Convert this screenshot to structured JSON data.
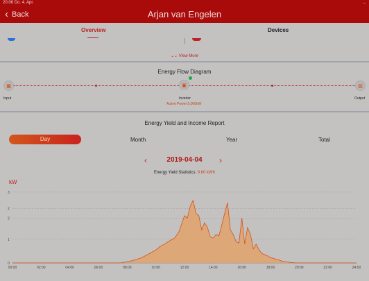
{
  "status_bar": {
    "time": "20:06",
    "date": "Do. 4. Apr.",
    "right": "..."
  },
  "nav": {
    "back_label": "Back",
    "title": "Arjan van Engelen"
  },
  "tabs": {
    "overview": "Overview",
    "devices": "Devices"
  },
  "summary": {
    "view_more": "View More"
  },
  "flow": {
    "title": "Energy Flow Diagram",
    "input_label": "Input",
    "inverter_label": "Inverter",
    "output_label": "Output",
    "active_power": "Active Power:0.000kW"
  },
  "report": {
    "title": "Energy Yield and Income Report",
    "segments": {
      "day": "Day",
      "month": "Month",
      "year": "Year",
      "total": "Total"
    },
    "date": "2019-04-04",
    "stats_label": "Energy Yield Statistics:",
    "stats_value": "9.60 kWh"
  },
  "colors": {
    "accent": "#a90b0b",
    "series_fill": "#e3a26b",
    "series_line": "#d2521a"
  },
  "chart_data": {
    "type": "area",
    "ylabel": "kW",
    "ylim": [
      0,
      3.2
    ],
    "yticks": [
      "0",
      "1",
      "2",
      "2",
      "3"
    ],
    "ytick_values": [
      0,
      1,
      1.9,
      2.3,
      3
    ],
    "xticks": [
      "00:00",
      "02:00",
      "04:00",
      "06:00",
      "08:00",
      "10:00",
      "12:00",
      "14:00",
      "16:00",
      "18:00",
      "20:00",
      "22:00",
      "24:00"
    ],
    "x": [
      0,
      7.5,
      8,
      8.5,
      9,
      9.5,
      10,
      10.3,
      10.6,
      11,
      11.3,
      11.6,
      12,
      12.2,
      12.4,
      12.6,
      12.8,
      13,
      13.2,
      13.4,
      13.6,
      13.8,
      14,
      14.2,
      14.4,
      14.6,
      14.8,
      15,
      15.2,
      15.4,
      15.6,
      15.8,
      16,
      16.2,
      16.4,
      16.6,
      16.8,
      17,
      17.2,
      17.4,
      17.6,
      17.8,
      18,
      18.2,
      18.4,
      18.6,
      18.8,
      19,
      19.2,
      19.4,
      19.6,
      19.8,
      20,
      24
    ],
    "series": [
      {
        "name": "",
        "values": [
          0,
          0,
          0.05,
          0.12,
          0.22,
          0.38,
          0.55,
          0.7,
          0.8,
          0.95,
          1.05,
          1.3,
          2.0,
          1.9,
          2.4,
          2.65,
          2.1,
          2.0,
          1.4,
          1.7,
          1.5,
          1.1,
          1.05,
          1.2,
          1.15,
          1.6,
          2.1,
          2.55,
          1.4,
          1.2,
          0.9,
          0.85,
          1.9,
          0.8,
          1.5,
          1.2,
          0.6,
          0.8,
          0.55,
          0.4,
          0.35,
          0.3,
          0.22,
          0.2,
          0.15,
          0.12,
          0.08,
          0.06,
          0.04,
          0.02,
          0.01,
          0,
          0,
          0
        ]
      }
    ]
  }
}
